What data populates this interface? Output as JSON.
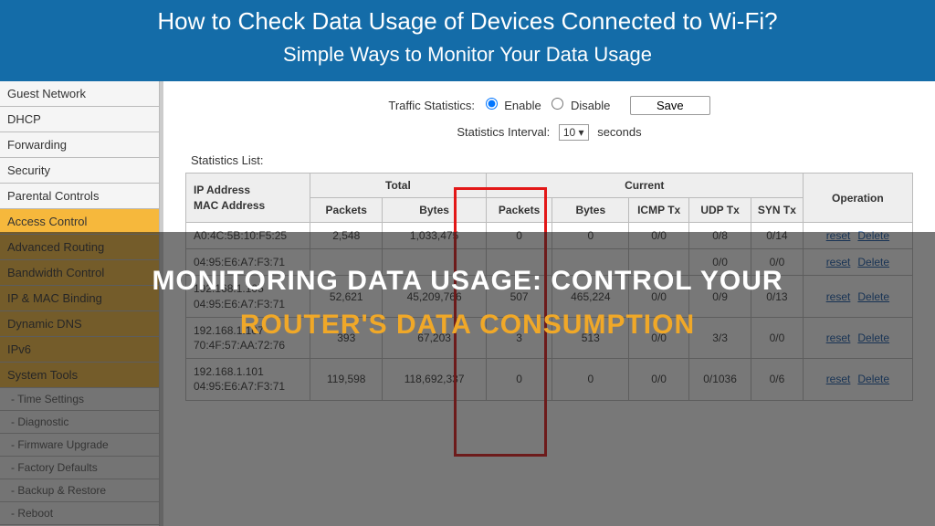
{
  "banner": {
    "title": "How to Check Data Usage of Devices Connected to Wi-Fi?",
    "subtitle": "Simple Ways to Monitor Your Data Usage"
  },
  "sidebar": {
    "items": [
      {
        "label": "Guest Network",
        "kind": "item"
      },
      {
        "label": "DHCP",
        "kind": "item"
      },
      {
        "label": "Forwarding",
        "kind": "item"
      },
      {
        "label": "Security",
        "kind": "item"
      },
      {
        "label": "Parental Controls",
        "kind": "item"
      },
      {
        "label": "Access Control",
        "kind": "item",
        "orange": true
      },
      {
        "label": "Advanced Routing",
        "kind": "item",
        "orange": true
      },
      {
        "label": "Bandwidth Control",
        "kind": "item",
        "orange": true
      },
      {
        "label": "IP & MAC Binding",
        "kind": "item",
        "orange": true
      },
      {
        "label": "Dynamic DNS",
        "kind": "item",
        "orange": true
      },
      {
        "label": "IPv6",
        "kind": "item",
        "orange": true
      },
      {
        "label": "System Tools",
        "kind": "item",
        "orange": true
      },
      {
        "label": "- Time Settings",
        "kind": "sub"
      },
      {
        "label": "- Diagnostic",
        "kind": "sub"
      },
      {
        "label": "- Firmware Upgrade",
        "kind": "sub"
      },
      {
        "label": "- Factory Defaults",
        "kind": "sub"
      },
      {
        "label": "- Backup & Restore",
        "kind": "sub"
      },
      {
        "label": "- Reboot",
        "kind": "sub"
      }
    ]
  },
  "controls": {
    "traffic_label": "Traffic Statistics:",
    "enable_label": "Enable",
    "disable_label": "Disable",
    "save_label": "Save",
    "interval_label": "Statistics Interval:",
    "interval_value": "10 ▾",
    "interval_unit": "seconds"
  },
  "table": {
    "list_label": "Statistics List:",
    "group_total": "Total",
    "group_current": "Current",
    "col_addr": "IP Address\nMAC Address",
    "col_packets": "Packets",
    "col_bytes": "Bytes",
    "col_cur_packets": "Packets",
    "col_cur_bytes": "Bytes",
    "col_icmp": "ICMP Tx",
    "col_udp": "UDP Tx",
    "col_syn": "SYN Tx",
    "col_op": "Operation",
    "link_reset": "reset",
    "link_delete": "Delete",
    "rows": [
      {
        "ip": "",
        "mac": "A0:4C:5B:10:F5:25",
        "packets": "2,548",
        "bytes": "1,033,475",
        "cp": "0",
        "cb": "0",
        "icmp": "0/0",
        "udp": "0/8",
        "syn": "0/14"
      },
      {
        "ip": "",
        "mac": "04:95:E6:A7:F3:71",
        "packets": "",
        "bytes": "",
        "cp": "",
        "cb": "",
        "icmp": "",
        "udp": "0/0",
        "syn": "0/0"
      },
      {
        "ip": "192.168.1.105",
        "mac": "04:95:E6:A7:F3:71",
        "packets": "52,621",
        "bytes": "45,209,766",
        "cp": "507",
        "cb": "465,224",
        "icmp": "0/0",
        "udp": "0/9",
        "syn": "0/13"
      },
      {
        "ip": "192.168.1.107",
        "mac": "70:4F:57:AA:72:76",
        "packets": "393",
        "bytes": "67,203",
        "cp": "3",
        "cb": "513",
        "icmp": "0/0",
        "udp": "3/3",
        "syn": "0/0"
      },
      {
        "ip": "192.168.1.101",
        "mac": "04:95:E6:A7:F3:71",
        "packets": "119,598",
        "bytes": "118,692,337",
        "cp": "0",
        "cb": "0",
        "icmp": "0/0",
        "udp": "0/1036",
        "syn": "0/6"
      }
    ]
  },
  "overlay": {
    "line1": "Monitoring Data Usage: Control Your",
    "line2": "Router's Data Consumption"
  }
}
